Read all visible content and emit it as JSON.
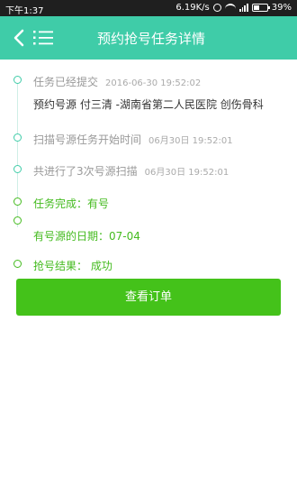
{
  "status_bar": {
    "time": "下午1:37",
    "net_speed": "6.19K/s",
    "battery": "39%"
  },
  "header": {
    "title": "预约抢号任务详情"
  },
  "timeline": {
    "submitted": {
      "label": "任务已经提交",
      "time": "2016-06-30 19:52:02"
    },
    "detail": "预约号源 付三清 -湖南省第二人民医院 创伤骨科",
    "scan_start": {
      "label": "扫描号源任务开始时间",
      "time": "06月30日 19:52:01"
    },
    "scan_count": {
      "label": "共进行了3次号源扫描",
      "time": "06月30日 19:52:01"
    },
    "completed": "任务完成：有号",
    "date": "有号源的日期：07-04",
    "result": "抢号结果： 成功"
  },
  "actions": {
    "view_order": "查看订单"
  },
  "colors": {
    "header": "#3fcca8",
    "button": "#44c21a",
    "success_text": "#44bb1f"
  }
}
